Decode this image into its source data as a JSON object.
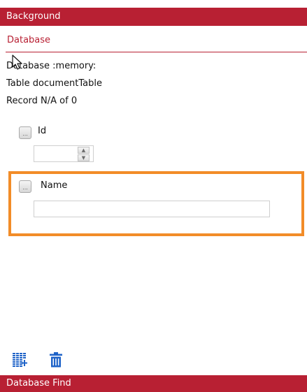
{
  "header": {
    "title": "Background"
  },
  "section": {
    "title": "Database"
  },
  "info": {
    "database": "Database :memory:",
    "table": "Table documentTable",
    "record": "Record N/A of 0"
  },
  "fields": {
    "id": {
      "label": "Id",
      "value": "",
      "button_glyph": "..."
    },
    "name": {
      "label": "Name",
      "value": "",
      "button_glyph": "..."
    }
  },
  "toolbar": {
    "add_icon": "add-record-icon",
    "delete_icon": "trash-icon"
  },
  "footer": {
    "title": "Database Find"
  },
  "colors": {
    "accent": "#b82033",
    "highlight": "#f28c28",
    "icon": "#1f63c8"
  }
}
